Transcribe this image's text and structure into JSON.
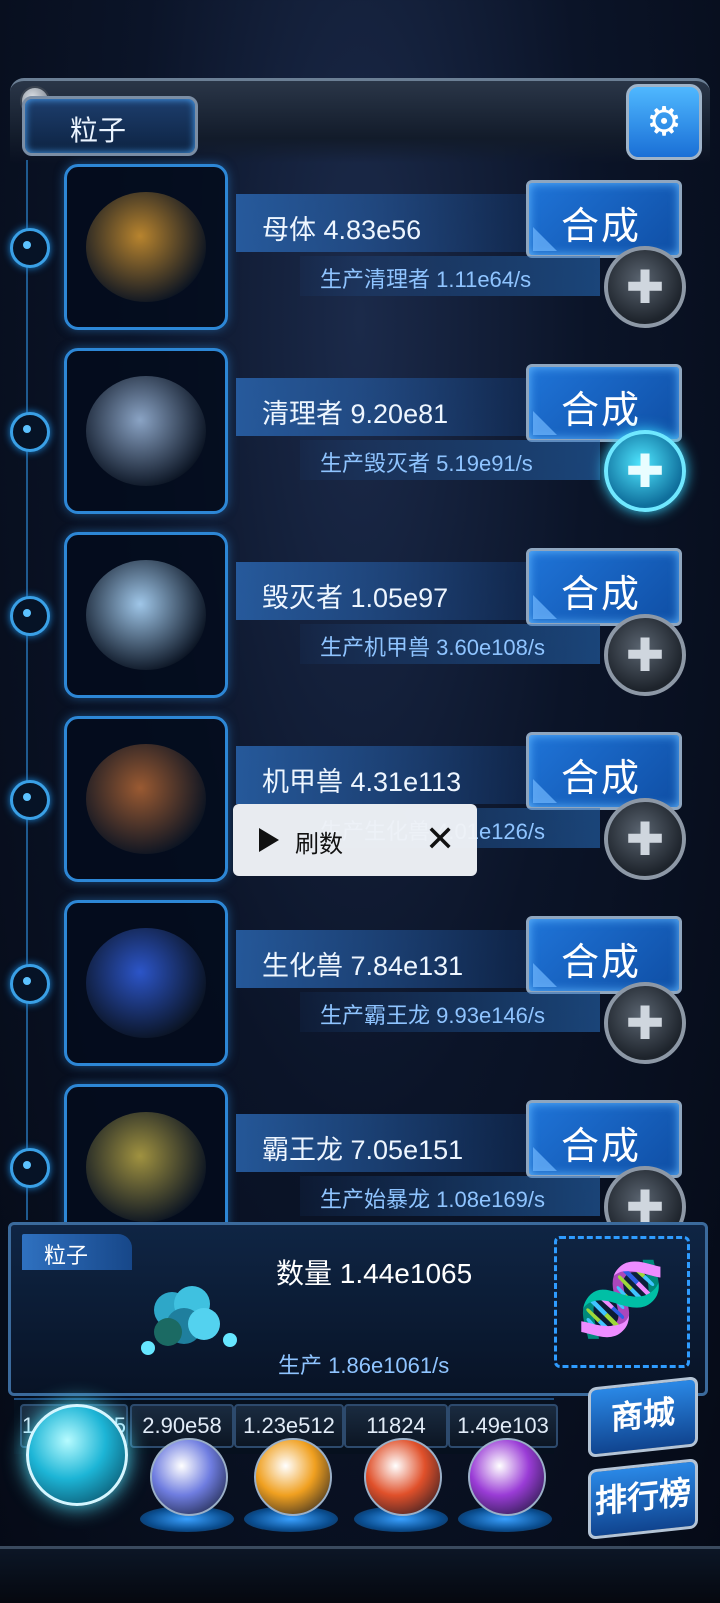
{
  "header": {
    "title": "粒子",
    "settings_icon": "gear-icon"
  },
  "items": [
    {
      "name": "母体",
      "amount": "4.83e56",
      "craft_label": "合成",
      "produce_label": "生产清理者",
      "produce_rate": "1.11e64/s",
      "plus_active": false,
      "creature": "larva-rock",
      "color": "#b8842e"
    },
    {
      "name": "清理者",
      "amount": "9.20e81",
      "craft_label": "合成",
      "produce_label": "生产毁灭者",
      "produce_rate": "5.19e91/s",
      "plus_active": true,
      "creature": "cleaner-bot",
      "color": "#8aa3c4"
    },
    {
      "name": "毁灭者",
      "amount": "1.05e97",
      "craft_label": "合成",
      "produce_label": "生产机甲兽",
      "produce_rate": "3.60e108/s",
      "plus_active": false,
      "creature": "destroyer-mech",
      "color": "#9fc6e8"
    },
    {
      "name": "机甲兽",
      "amount": "4.31e113",
      "craft_label": "合成",
      "produce_label": "生产生化兽",
      "produce_rate": "4.01e126/s",
      "plus_active": false,
      "creature": "mech-beast",
      "color": "#9a5a32"
    },
    {
      "name": "生化兽",
      "amount": "7.84e131",
      "craft_label": "合成",
      "produce_label": "生产霸王龙",
      "produce_rate": "9.93e146/s",
      "plus_active": false,
      "creature": "bio-beast",
      "color": "#2c55c8"
    },
    {
      "name": "霸王龙",
      "amount": "7.05e151",
      "craft_label": "合成",
      "produce_label": "生产始暴龙",
      "produce_rate": "1.08e169/s",
      "plus_active": false,
      "creature": "t-rex",
      "color": "#a09240"
    }
  ],
  "popup": {
    "label": "刷数",
    "play_icon": "play-icon",
    "close_icon": "close-icon"
  },
  "bottom": {
    "tab_label": "粒子",
    "count_label": "数量",
    "count_value": "1.44e1065",
    "rate_label": "生产",
    "rate_value": "1.86e1061/s",
    "dna_icon": "dna-icon"
  },
  "currencies": [
    {
      "value": "1.__e1065",
      "orb": "particle-orb",
      "color": "#35d4ff"
    },
    {
      "value": "2.90e58",
      "orb": "lightning-orb",
      "color": "#6f7de0"
    },
    {
      "value": "1.23e512",
      "orb": "fire-orb",
      "color": "#f0a020"
    },
    {
      "value": "11824",
      "orb": "brain-orb",
      "color": "#e0502a"
    },
    {
      "value": "1.49e103",
      "orb": "vortex-orb",
      "color": "#9a3cd6"
    }
  ],
  "side_buttons": {
    "shop": "商城",
    "rank": "排行榜"
  }
}
